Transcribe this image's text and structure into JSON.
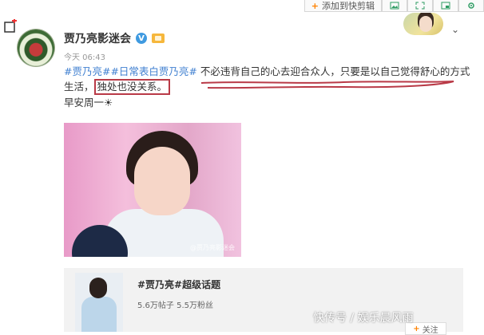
{
  "toolbar": {
    "add_label": "添加到快剪辑",
    "plus": "+",
    "icons": [
      "image-icon",
      "expand-icon",
      "window-icon",
      "settings-icon"
    ]
  },
  "post": {
    "author": "贾乃亮影迷会",
    "time": "今天 06:43",
    "tags": [
      "#贾乃亮#",
      "#日常表白贾乃亮#"
    ],
    "text_part1": "不必违背自己的心去迎合众人，只要是以自己觉得舒心的方式生活，",
    "boxed_text": "独处也没关系。",
    "greeting": "早安周一",
    "image_watermark": "@贾乃亮影迷会"
  },
  "topic_card": {
    "title": "#贾乃亮#超级话题",
    "meta": "5.6万帖子 5.5万粉丝",
    "follow_label": "关注",
    "plus": "+"
  },
  "watermark_text": "快传号 / 娱乐晨风雨",
  "colors": {
    "link": "#3f7fd0",
    "highlight_box": "#b93a47",
    "accent": "#ff8200"
  }
}
